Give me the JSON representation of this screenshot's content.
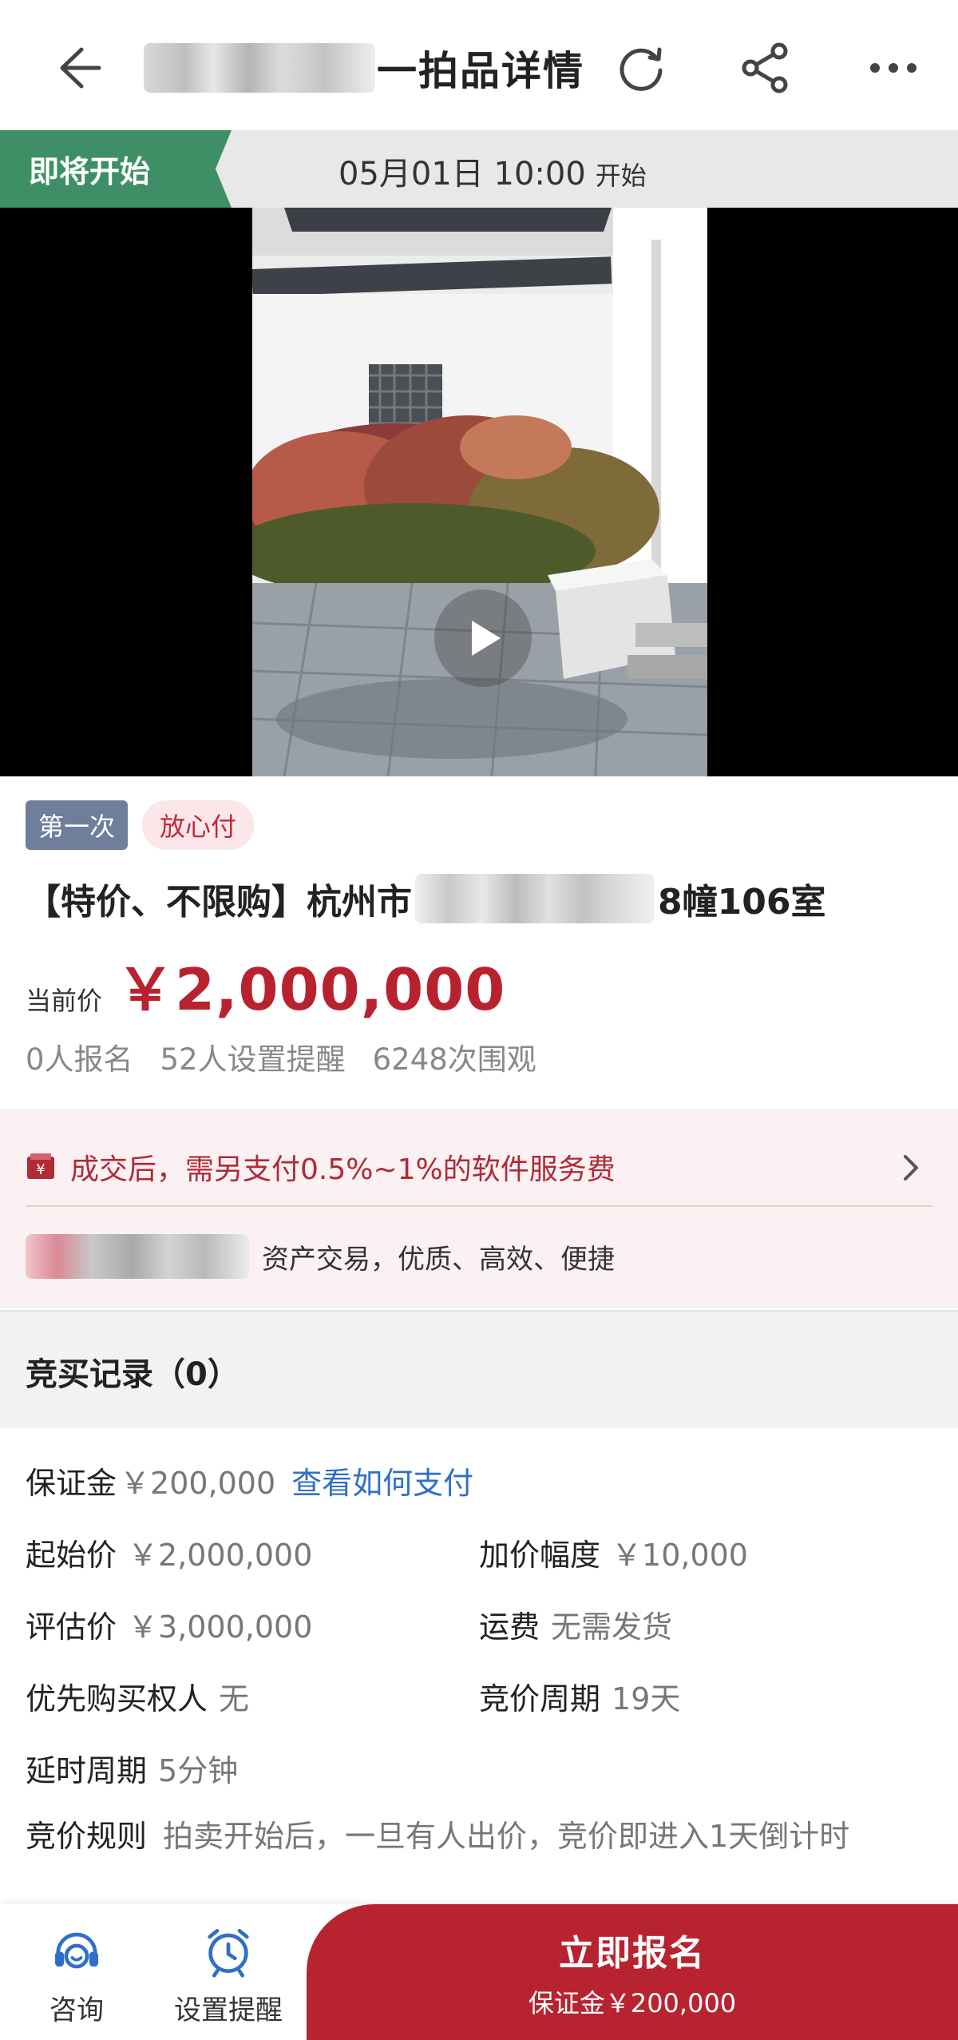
{
  "header": {
    "title": "一拍品详情"
  },
  "status": {
    "tag": "即将开始",
    "datetime": "05月01日 10:00",
    "start_label": "开始"
  },
  "item": {
    "tags": [
      "第一次",
      "放心付"
    ],
    "title_prefix": "【特价、不限购】杭州市",
    "title_suffix": "8幢106室",
    "price_label": "当前价",
    "price": "￥2,000,000",
    "stats": [
      "0人报名",
      "52人设置提醒",
      "6248次围观"
    ]
  },
  "notice": {
    "fee_text": "成交后，需另支付0.5%~1%的软件服务费",
    "slogan": "资产交易，优质、高效、便捷"
  },
  "bid_records": {
    "title": "竞买记录（0）"
  },
  "details": {
    "deposit_label": "保证金",
    "deposit_value": "￥200,000",
    "deposit_link": "查看如何支付",
    "start_price_label": "起始价",
    "start_price_value": "￥2,000,000",
    "increment_label": "加价幅度",
    "increment_value": "￥10,000",
    "appraisal_label": "评估价",
    "appraisal_value": "￥3,000,000",
    "shipping_label": "运费",
    "shipping_value": "无需发货",
    "priority_label": "优先购买权人",
    "priority_value": "无",
    "cycle_label": "竞价周期",
    "cycle_value": "19天",
    "delay_label": "延时周期",
    "delay_value": "5分钟",
    "rule_label": "竞价规则",
    "rule_value": "拍卖开始后，一旦有人出价，竞价即进入1天倒计时"
  },
  "bottom_bar": {
    "consult_label": "咨询",
    "remind_label": "设置提醒",
    "cta_label": "立即报名",
    "cta_sub": "保证金￥200,000"
  },
  "colors": {
    "accent_red": "#b7232f",
    "status_green": "#3f8f66",
    "link_blue": "#2f6fc9",
    "tag_blue": "#6f7f9b"
  },
  "icons": [
    "back-arrow-icon",
    "refresh-icon",
    "share-icon",
    "more-icon",
    "play-icon",
    "wallet-icon",
    "chevron-right-icon",
    "headset-icon",
    "alarm-clock-icon"
  ]
}
